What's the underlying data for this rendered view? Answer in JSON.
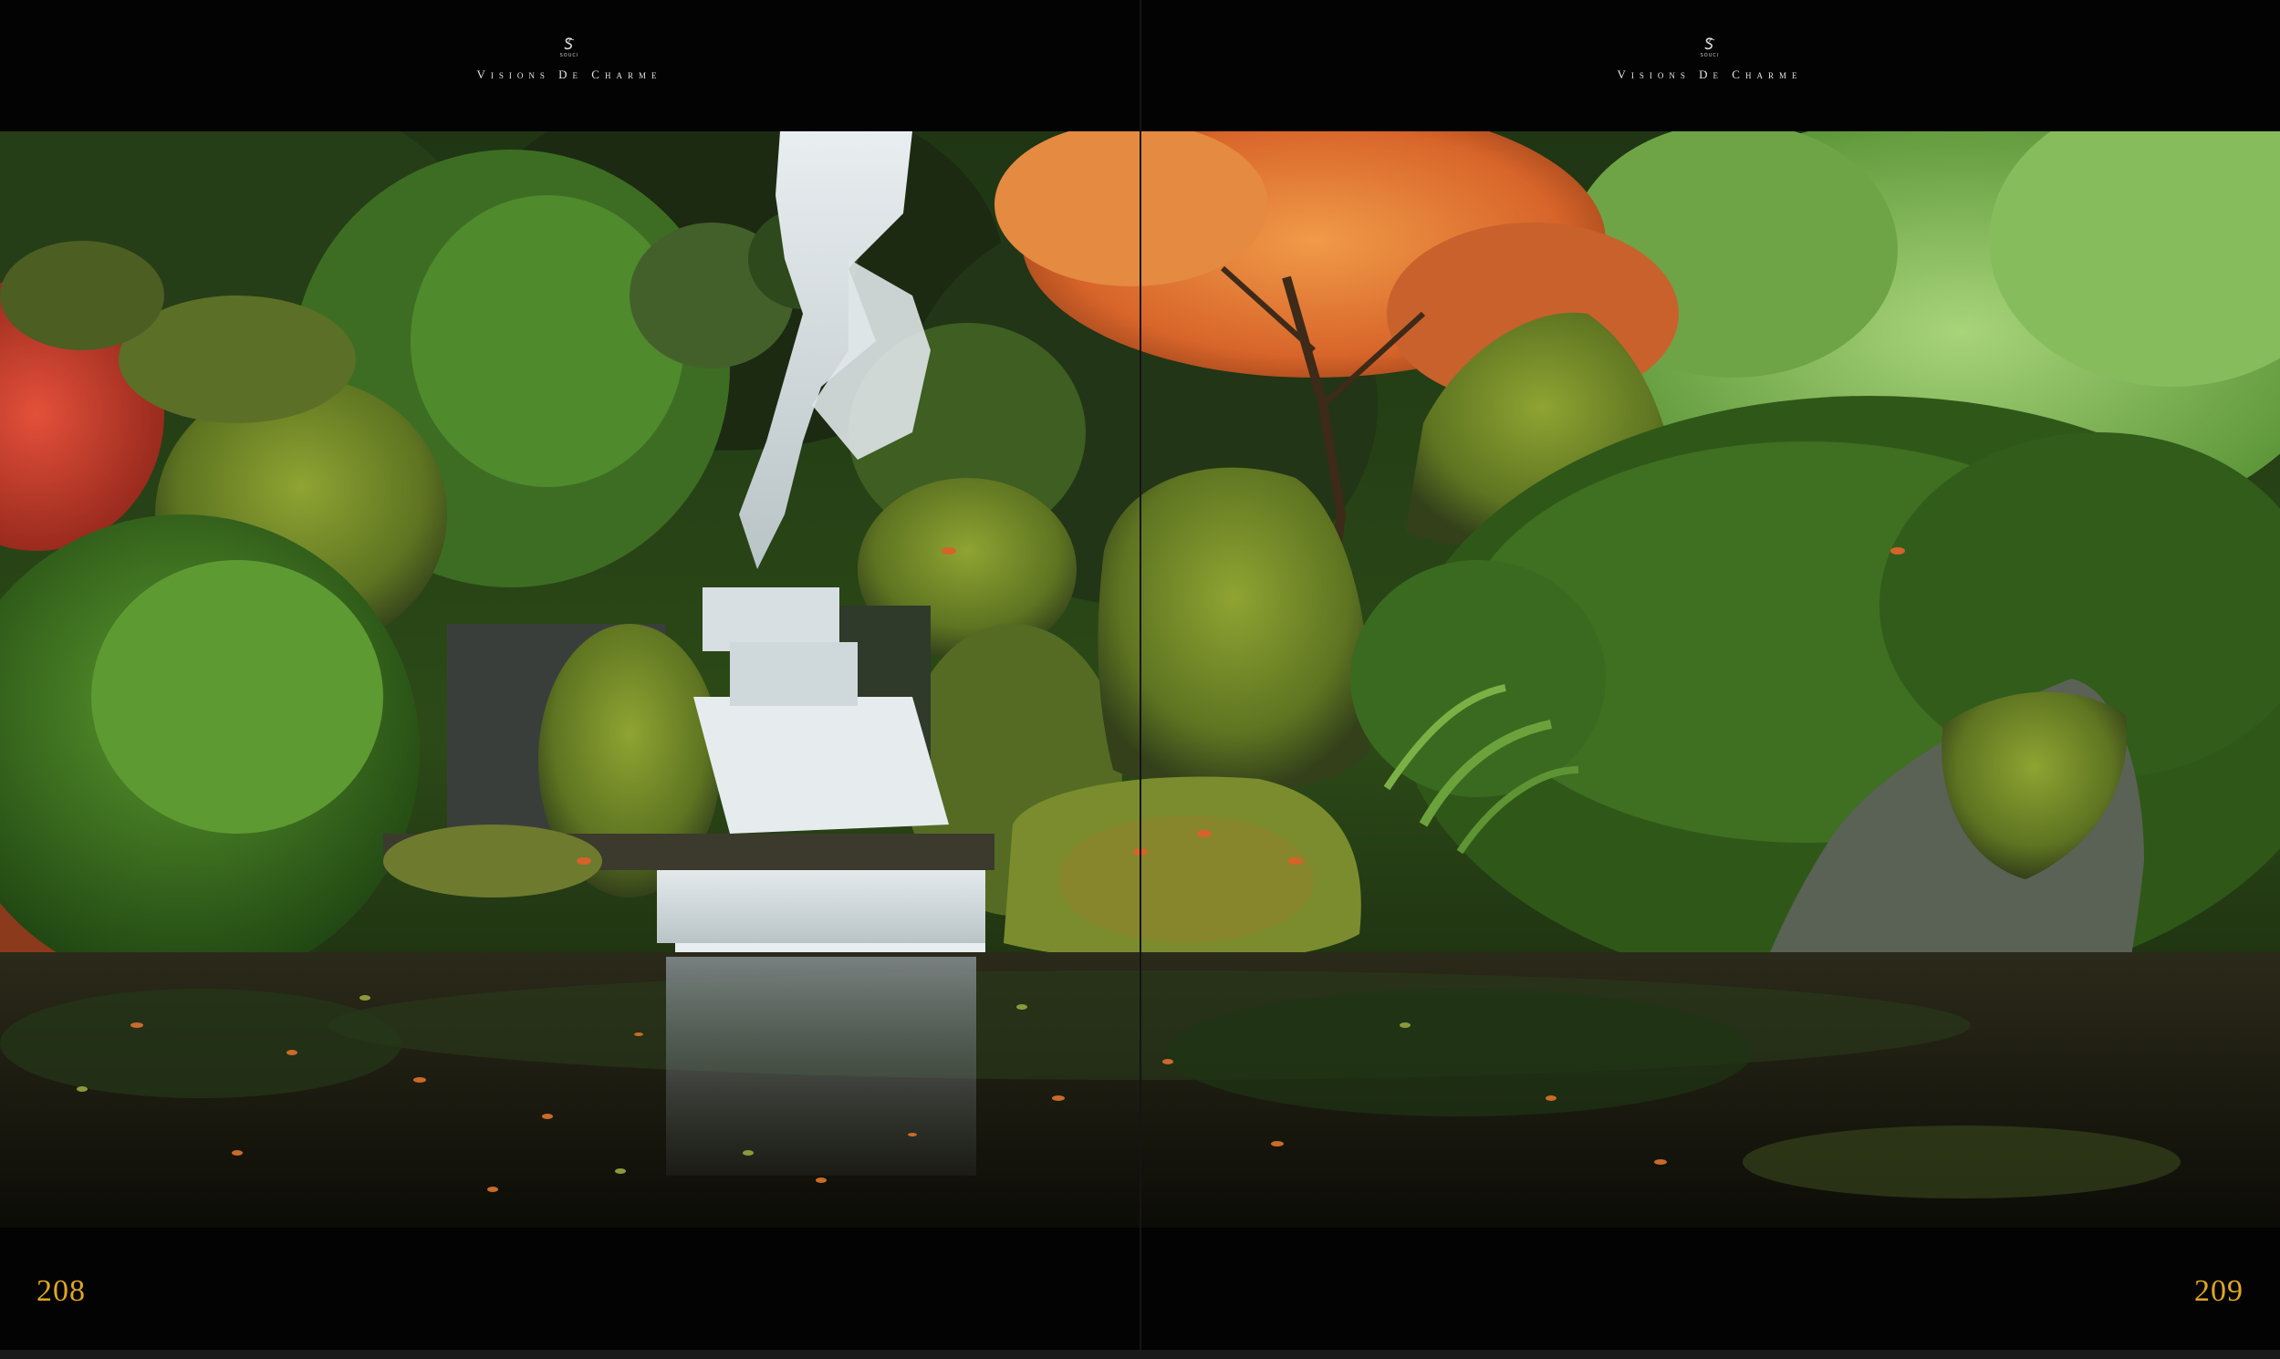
{
  "spread": {
    "left_page": {
      "brand_wordmark": "SOUCI",
      "header_tagline": "Visions De Charme",
      "page_number": "208"
    },
    "right_page": {
      "brand_wordmark": "SOUCI",
      "header_tagline": "Visions De Charme",
      "page_number": "209"
    }
  },
  "colors": {
    "background": "#030303",
    "folio": "#e0a623",
    "tagline": "#e6e6e6"
  },
  "photo": {
    "icon": "garden-waterfall-photo"
  }
}
